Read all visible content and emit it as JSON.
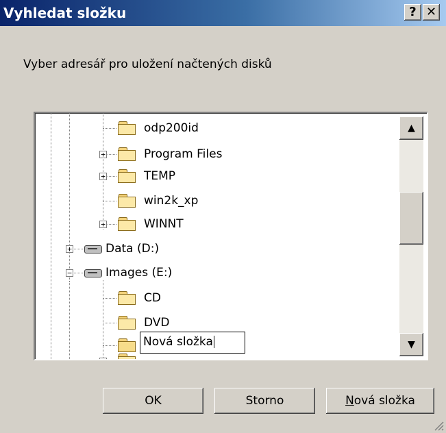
{
  "dialog": {
    "title": "Vyhledat složku",
    "help_label": "?",
    "close_label": "✕",
    "prompt": "Vyber adresář pro uložení načtených disků"
  },
  "tree": {
    "items": [
      {
        "label": "odp200id",
        "icon": "folder-icon"
      },
      {
        "label": "Program Files",
        "icon": "folder-icon"
      },
      {
        "label": "TEMP",
        "icon": "folder-icon"
      },
      {
        "label": "win2k_xp",
        "icon": "folder-icon"
      },
      {
        "label": "WINNT",
        "icon": "folder-icon"
      },
      {
        "label": "Data (D:)",
        "icon": "drive-icon"
      },
      {
        "label": "Images (E:)",
        "icon": "drive-icon"
      },
      {
        "label": "CD",
        "icon": "folder-icon"
      },
      {
        "label": "DVD",
        "icon": "folder-icon"
      }
    ],
    "editing_value": "Nová složka",
    "expander_plus": "+",
    "expander_minus": "−"
  },
  "scrollbar": {
    "up_glyph": "▲",
    "down_glyph": "▼"
  },
  "buttons": {
    "ok": "OK",
    "cancel": "Storno",
    "new_folder_accel": "N",
    "new_folder_rest": "ová složka"
  },
  "colors": {
    "title_start": "#0a246a",
    "title_end": "#a6caf0",
    "face": "#d4d0c8",
    "folder": "#fce9a8"
  }
}
